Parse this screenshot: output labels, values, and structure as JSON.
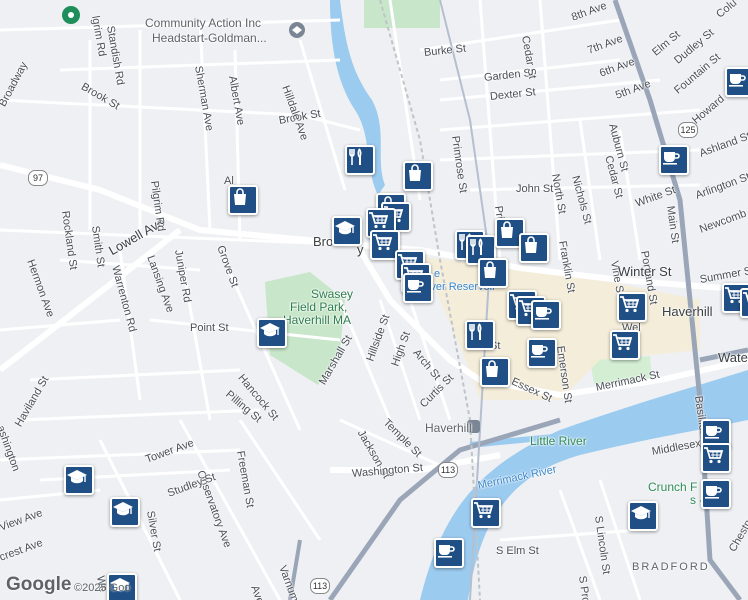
{
  "map": {
    "labels": {
      "community_action": "Community Action Inc",
      "headstart": "Headstart-Goldman...",
      "swasey_park_1": "Swasey",
      "swasey_park_2": "Field Park,",
      "swasey_park_3": "Haverhill MA",
      "river_reservoir": "River Reservoir",
      "river_reservoir_prefix": "e",
      "haverhill_station": "Haverhill",
      "haverhill_city": "Haverhill",
      "little_river": "Little River",
      "merrimack_river": "Merrimack River",
      "crunch": "Crunch F",
      "crunch_sub": "s - H",
      "bradford": "BRADFORD",
      "streets": {
        "standish_rd": "Standish Rd",
        "pilgrim_rd_top": "lgrim Rd",
        "brook_st_w": "Brook St",
        "brook_st": "Brook St",
        "sherman_ave": "Sherman Ave",
        "albert_ave": "Albert Ave",
        "hilldale_ave": "Hilldale Ave",
        "burke_st": "Burke St",
        "garden_st": "Garden St",
        "dexter_st": "Dexter St",
        "cedar_st": "Cedar St",
        "eighth_ave": "8th Ave",
        "seventh_ave": "7th Ave",
        "sixth_ave": "6th Ave",
        "fifth_ave": "5th Ave",
        "elm_st": "Elm St",
        "dudley_st": "Dudley St",
        "fountain_st": "Fountain St",
        "howard": "Howard",
        "colu": "Colu",
        "primrose_st": "Primrose St",
        "pri": "Pri",
        "john_st": "John St",
        "north_st": "North St",
        "nichols_st": "Nichols St",
        "cedar_st2": "Cedar St",
        "auburn_st": "Auburn St",
        "white_st": "White St",
        "ashland_st": "Ashland St",
        "arlington_st": "Arlington St",
        "newcomb_st": "Newcomb St",
        "main_st": "Main St",
        "broadway_nw": "Broadway",
        "broadway": "Broad",
        "broadway_tail": "y",
        "lowell_ave": "Lowell Ave",
        "rockland_st": "Rockland St",
        "smith_st": "Smith St",
        "hermon_ave": "Hermon Ave",
        "pilgrim_rd": "Pilgrim Rd",
        "al": "Al",
        "grove_st": "Grove St",
        "lansing_ave": "Lansing Ave",
        "warrenton": "Warrenton Rd",
        "juniper_rd": "Juniper Rd",
        "point_st": "Point St",
        "hancock_st": "Hancock St",
        "pilling_st": "Pilling St",
        "marshall_st": "Marshall St",
        "hillside_st": "Hillside St",
        "high_st": "High St",
        "arch_st": "Arch St",
        "curtis_st": "Curtis St",
        "temple_st": "Temple St",
        "jackson_st": "Jackson St",
        "washington_st": "Washington St",
        "essex_st": "Essex St",
        "merrimack_st": "Merrimack St",
        "emerson_st": "Emerson St",
        "franklin_st": "Franklin St",
        "vine_st": "Vine St",
        "portland_st": "Portland St",
        "winter_st": "Winter St",
        "summer_st": "Summer St",
        "wel": "Wel",
        "water": "Water",
        "basiliere": "Basilliere",
        "middlesex": "Middlesex",
        "haviland_st": "Haviland St",
        "ashington": "ashington",
        "tower_ave": "Tower Ave",
        "observatory_ave": "Observatory Ave",
        "freeman_st": "Freeman St",
        "studley_st": "Studley St",
        "silver_st": "Silver St",
        "view_ave": "View Ave",
        "crest_ave": "crest Ave",
        "varnum": "Varnum St",
        "aver": "Aver",
        "s_elm_st": "S Elm St",
        "s_lincoln": "S Lincoln St",
        "s_pros": "S Pros",
        "chestn": "Chestn",
        "st_partial": "St",
        "we": "We"
      },
      "routes": {
        "r97": "97",
        "r125": "125",
        "r113a": "113",
        "r113b": "113"
      }
    },
    "attribution": {
      "logo": "Google",
      "copyright": "©2025 Goo"
    },
    "markers": [
      {
        "type": "cafe",
        "icon": "coffee-cup-icon"
      },
      {
        "type": "restaurant",
        "icon": "fork-knife-icon"
      },
      {
        "type": "shop",
        "icon": "shopping-bag-icon"
      },
      {
        "type": "school",
        "icon": "graduation-cap-icon"
      },
      {
        "type": "grocery",
        "icon": "shopping-cart-icon"
      }
    ],
    "colors": {
      "marker": "#1f4f85",
      "water": "#9ccbf0",
      "park": "#c8e6c9",
      "road": "#ffffff",
      "highway": "#9aa6b8",
      "downtown": "#f5ecd2"
    }
  }
}
